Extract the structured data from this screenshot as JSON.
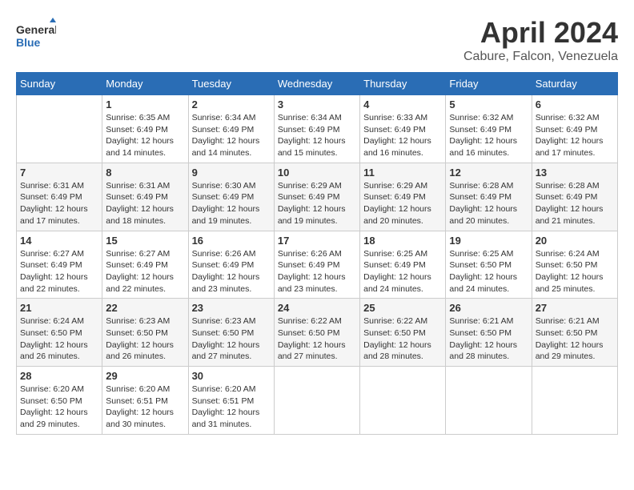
{
  "header": {
    "logo": {
      "text_general": "General",
      "text_blue": "Blue"
    },
    "title": "April 2024",
    "subtitle": "Cabure, Falcon, Venezuela"
  },
  "days_of_week": [
    "Sunday",
    "Monday",
    "Tuesday",
    "Wednesday",
    "Thursday",
    "Friday",
    "Saturday"
  ],
  "weeks": [
    [
      {
        "day": "",
        "sunrise": "",
        "sunset": "",
        "daylight": ""
      },
      {
        "day": "1",
        "sunrise": "Sunrise: 6:35 AM",
        "sunset": "Sunset: 6:49 PM",
        "daylight": "Daylight: 12 hours and 14 minutes."
      },
      {
        "day": "2",
        "sunrise": "Sunrise: 6:34 AM",
        "sunset": "Sunset: 6:49 PM",
        "daylight": "Daylight: 12 hours and 14 minutes."
      },
      {
        "day": "3",
        "sunrise": "Sunrise: 6:34 AM",
        "sunset": "Sunset: 6:49 PM",
        "daylight": "Daylight: 12 hours and 15 minutes."
      },
      {
        "day": "4",
        "sunrise": "Sunrise: 6:33 AM",
        "sunset": "Sunset: 6:49 PM",
        "daylight": "Daylight: 12 hours and 16 minutes."
      },
      {
        "day": "5",
        "sunrise": "Sunrise: 6:32 AM",
        "sunset": "Sunset: 6:49 PM",
        "daylight": "Daylight: 12 hours and 16 minutes."
      },
      {
        "day": "6",
        "sunrise": "Sunrise: 6:32 AM",
        "sunset": "Sunset: 6:49 PM",
        "daylight": "Daylight: 12 hours and 17 minutes."
      }
    ],
    [
      {
        "day": "7",
        "sunrise": "Sunrise: 6:31 AM",
        "sunset": "Sunset: 6:49 PM",
        "daylight": "Daylight: 12 hours and 17 minutes."
      },
      {
        "day": "8",
        "sunrise": "Sunrise: 6:31 AM",
        "sunset": "Sunset: 6:49 PM",
        "daylight": "Daylight: 12 hours and 18 minutes."
      },
      {
        "day": "9",
        "sunrise": "Sunrise: 6:30 AM",
        "sunset": "Sunset: 6:49 PM",
        "daylight": "Daylight: 12 hours and 19 minutes."
      },
      {
        "day": "10",
        "sunrise": "Sunrise: 6:29 AM",
        "sunset": "Sunset: 6:49 PM",
        "daylight": "Daylight: 12 hours and 19 minutes."
      },
      {
        "day": "11",
        "sunrise": "Sunrise: 6:29 AM",
        "sunset": "Sunset: 6:49 PM",
        "daylight": "Daylight: 12 hours and 20 minutes."
      },
      {
        "day": "12",
        "sunrise": "Sunrise: 6:28 AM",
        "sunset": "Sunset: 6:49 PM",
        "daylight": "Daylight: 12 hours and 20 minutes."
      },
      {
        "day": "13",
        "sunrise": "Sunrise: 6:28 AM",
        "sunset": "Sunset: 6:49 PM",
        "daylight": "Daylight: 12 hours and 21 minutes."
      }
    ],
    [
      {
        "day": "14",
        "sunrise": "Sunrise: 6:27 AM",
        "sunset": "Sunset: 6:49 PM",
        "daylight": "Daylight: 12 hours and 22 minutes."
      },
      {
        "day": "15",
        "sunrise": "Sunrise: 6:27 AM",
        "sunset": "Sunset: 6:49 PM",
        "daylight": "Daylight: 12 hours and 22 minutes."
      },
      {
        "day": "16",
        "sunrise": "Sunrise: 6:26 AM",
        "sunset": "Sunset: 6:49 PM",
        "daylight": "Daylight: 12 hours and 23 minutes."
      },
      {
        "day": "17",
        "sunrise": "Sunrise: 6:26 AM",
        "sunset": "Sunset: 6:49 PM",
        "daylight": "Daylight: 12 hours and 23 minutes."
      },
      {
        "day": "18",
        "sunrise": "Sunrise: 6:25 AM",
        "sunset": "Sunset: 6:49 PM",
        "daylight": "Daylight: 12 hours and 24 minutes."
      },
      {
        "day": "19",
        "sunrise": "Sunrise: 6:25 AM",
        "sunset": "Sunset: 6:50 PM",
        "daylight": "Daylight: 12 hours and 24 minutes."
      },
      {
        "day": "20",
        "sunrise": "Sunrise: 6:24 AM",
        "sunset": "Sunset: 6:50 PM",
        "daylight": "Daylight: 12 hours and 25 minutes."
      }
    ],
    [
      {
        "day": "21",
        "sunrise": "Sunrise: 6:24 AM",
        "sunset": "Sunset: 6:50 PM",
        "daylight": "Daylight: 12 hours and 26 minutes."
      },
      {
        "day": "22",
        "sunrise": "Sunrise: 6:23 AM",
        "sunset": "Sunset: 6:50 PM",
        "daylight": "Daylight: 12 hours and 26 minutes."
      },
      {
        "day": "23",
        "sunrise": "Sunrise: 6:23 AM",
        "sunset": "Sunset: 6:50 PM",
        "daylight": "Daylight: 12 hours and 27 minutes."
      },
      {
        "day": "24",
        "sunrise": "Sunrise: 6:22 AM",
        "sunset": "Sunset: 6:50 PM",
        "daylight": "Daylight: 12 hours and 27 minutes."
      },
      {
        "day": "25",
        "sunrise": "Sunrise: 6:22 AM",
        "sunset": "Sunset: 6:50 PM",
        "daylight": "Daylight: 12 hours and 28 minutes."
      },
      {
        "day": "26",
        "sunrise": "Sunrise: 6:21 AM",
        "sunset": "Sunset: 6:50 PM",
        "daylight": "Daylight: 12 hours and 28 minutes."
      },
      {
        "day": "27",
        "sunrise": "Sunrise: 6:21 AM",
        "sunset": "Sunset: 6:50 PM",
        "daylight": "Daylight: 12 hours and 29 minutes."
      }
    ],
    [
      {
        "day": "28",
        "sunrise": "Sunrise: 6:20 AM",
        "sunset": "Sunset: 6:50 PM",
        "daylight": "Daylight: 12 hours and 29 minutes."
      },
      {
        "day": "29",
        "sunrise": "Sunrise: 6:20 AM",
        "sunset": "Sunset: 6:51 PM",
        "daylight": "Daylight: 12 hours and 30 minutes."
      },
      {
        "day": "30",
        "sunrise": "Sunrise: 6:20 AM",
        "sunset": "Sunset: 6:51 PM",
        "daylight": "Daylight: 12 hours and 31 minutes."
      },
      {
        "day": "",
        "sunrise": "",
        "sunset": "",
        "daylight": ""
      },
      {
        "day": "",
        "sunrise": "",
        "sunset": "",
        "daylight": ""
      },
      {
        "day": "",
        "sunrise": "",
        "sunset": "",
        "daylight": ""
      },
      {
        "day": "",
        "sunrise": "",
        "sunset": "",
        "daylight": ""
      }
    ]
  ]
}
